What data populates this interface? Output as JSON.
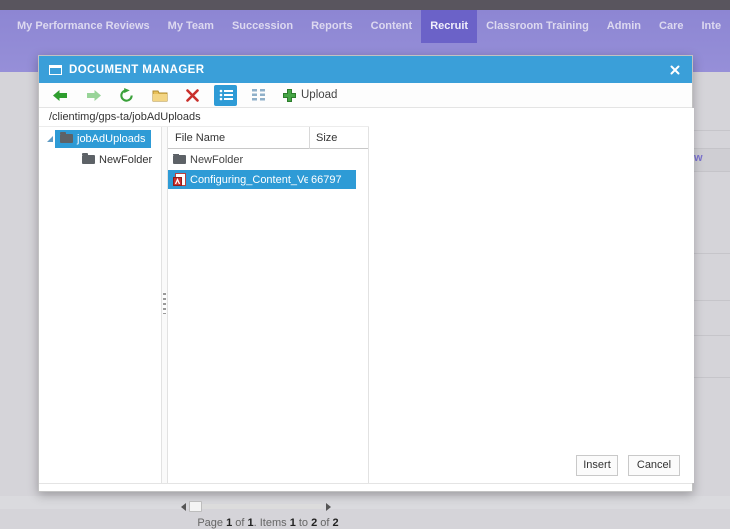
{
  "colors": {
    "top_strip": "#59555e",
    "nav_bg": "#8d86d3",
    "nav_active_bg": "#6b62c8",
    "titlebar_blue": "#3a9fd9",
    "selection_blue": "#2e9bd6",
    "green_accent": "#3aa13a",
    "red_accent": "#c9302c"
  },
  "nav": {
    "items": [
      {
        "label": "My Performance Reviews",
        "active": false
      },
      {
        "label": "My Team",
        "active": false
      },
      {
        "label": "Succession",
        "active": false
      },
      {
        "label": "Reports",
        "active": false
      },
      {
        "label": "Content",
        "active": false
      },
      {
        "label": "Recruit",
        "active": true
      },
      {
        "label": "Classroom Training",
        "active": false
      },
      {
        "label": "Admin",
        "active": false
      },
      {
        "label": "Care",
        "active": false
      },
      {
        "label": "Inte",
        "active": false
      }
    ]
  },
  "background": {
    "partial_text": "w"
  },
  "dialog": {
    "title": "DOCUMENT MANAGER",
    "toolbar": {
      "buttons": [
        {
          "name": "back",
          "icon": "back-arrow-icon"
        },
        {
          "name": "forward",
          "icon": "forward-arrow-icon"
        },
        {
          "name": "refresh",
          "icon": "refresh-icon"
        },
        {
          "name": "new-folder",
          "icon": "new-folder-icon"
        },
        {
          "name": "delete",
          "icon": "delete-icon"
        },
        {
          "name": "list-view",
          "icon": "list-view-icon",
          "active": true
        },
        {
          "name": "grid-view",
          "icon": "grid-view-icon",
          "active": false
        }
      ],
      "upload_label": "Upload"
    },
    "address_path": "/clientimg/gps-ta/jobAdUploads",
    "tree": {
      "nodes": [
        {
          "label": "jobAdUploads",
          "selected": true,
          "expanded": true,
          "indent": 0
        },
        {
          "label": "NewFolder",
          "selected": false,
          "expanded": false,
          "indent": 1
        }
      ]
    },
    "grid": {
      "columns": [
        {
          "label": "File Name"
        },
        {
          "label": "Size"
        }
      ],
      "rows": [
        {
          "name": "NewFolder",
          "size": "",
          "icon": "folder",
          "selected": false
        },
        {
          "name": "Configuring_Content_Vendo",
          "size": "66797",
          "icon": "pdf",
          "selected": true
        }
      ],
      "pagination": [
        {
          "text": "Page ",
          "bold": false
        },
        {
          "text": "1",
          "bold": true
        },
        {
          "text": " of ",
          "bold": false
        },
        {
          "text": "1",
          "bold": true
        },
        {
          "text": ". Items ",
          "bold": false
        },
        {
          "text": "1",
          "bold": true
        },
        {
          "text": " to ",
          "bold": false
        },
        {
          "text": "2",
          "bold": true
        },
        {
          "text": " of ",
          "bold": false
        },
        {
          "text": "2",
          "bold": true
        }
      ]
    },
    "footer": {
      "insert": "Insert",
      "cancel": "Cancel"
    }
  }
}
